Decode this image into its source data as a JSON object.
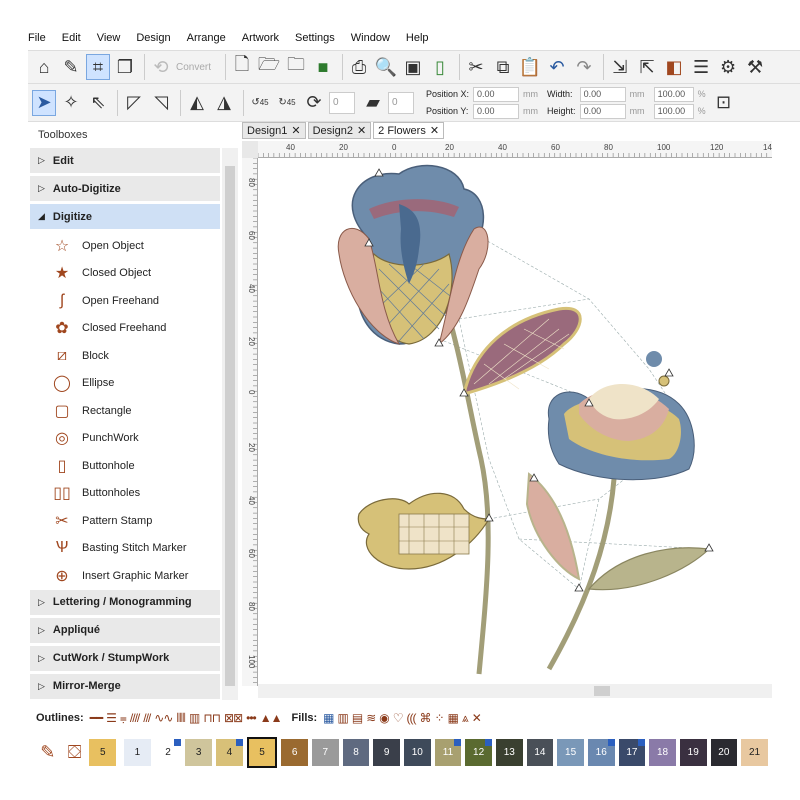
{
  "menu": [
    "File",
    "Edit",
    "View",
    "Design",
    "Arrange",
    "Artwork",
    "Settings",
    "Window",
    "Help"
  ],
  "toolbar": {
    "convert_label": "Convert",
    "angle_45a": "45",
    "angle_45b": "45",
    "zero_a": "0",
    "zero_b": "0"
  },
  "position": {
    "x_label": "Position X:",
    "x_value": "0.00",
    "x_unit": "mm",
    "y_label": "Position Y:",
    "y_value": "0.00",
    "y_unit": "mm",
    "width_label": "Width:",
    "width_value": "0.00",
    "width_unit": "mm",
    "height_label": "Height:",
    "height_value": "0.00",
    "height_unit": "mm",
    "scale_x": "100.00",
    "scale_y": "100.00",
    "percent": "%"
  },
  "toolboxes": {
    "title": "Toolboxes",
    "sections_top": [
      {
        "label": "Edit",
        "arrow": "▷"
      },
      {
        "label": "Auto-Digitize",
        "arrow": "▷"
      }
    ],
    "open_section": {
      "label": "Digitize",
      "arrow": "◢"
    },
    "tools": [
      {
        "label": "Open Object",
        "icon": "open-object-icon"
      },
      {
        "label": "Closed Object",
        "icon": "closed-object-icon"
      },
      {
        "label": "Open Freehand",
        "icon": "open-freehand-icon"
      },
      {
        "label": "Closed Freehand",
        "icon": "closed-freehand-icon"
      },
      {
        "label": "Block",
        "icon": "block-icon"
      },
      {
        "label": "Ellipse",
        "icon": "ellipse-icon"
      },
      {
        "label": "Rectangle",
        "icon": "rectangle-icon"
      },
      {
        "label": "PunchWork",
        "icon": "punchwork-icon"
      },
      {
        "label": "Buttonhole",
        "icon": "buttonhole-icon"
      },
      {
        "label": "Buttonholes",
        "icon": "buttonholes-icon"
      },
      {
        "label": "Pattern Stamp",
        "icon": "pattern-stamp-icon"
      },
      {
        "label": "Basting Stitch Marker",
        "icon": "basting-stitch-marker-icon"
      },
      {
        "label": "Insert Graphic Marker",
        "icon": "insert-graphic-marker-icon"
      }
    ],
    "sections_bottom": [
      {
        "label": "Lettering / Monogramming",
        "arrow": "▷"
      },
      {
        "label": "Appliqué",
        "arrow": "▷"
      },
      {
        "label": "CutWork / StumpWork",
        "arrow": "▷"
      },
      {
        "label": "Mirror-Merge",
        "arrow": "▷"
      }
    ]
  },
  "tabs": [
    {
      "label": "Design1",
      "active": false
    },
    {
      "label": "Design2",
      "active": false
    },
    {
      "label": "2 Flowers",
      "active": true
    }
  ],
  "tab_close": "✕",
  "ruler_h": [
    "40",
    "20",
    "0",
    "20",
    "40",
    "60",
    "80",
    "100",
    "120",
    "14"
  ],
  "ruler_v": [
    "80",
    "60",
    "40",
    "20",
    "0",
    "20",
    "40",
    "60",
    "80",
    "100"
  ],
  "outlines_label": "Outlines:",
  "fills_label": "Fills:",
  "current_color": "5",
  "colors": [
    {
      "n": "1",
      "hex": "#e6ecf5",
      "fg": "#222",
      "flag": false
    },
    {
      "n": "2",
      "hex": "#ffffff",
      "fg": "#222",
      "flag": true
    },
    {
      "n": "3",
      "hex": "#cfc59c",
      "fg": "#222",
      "flag": false
    },
    {
      "n": "4",
      "hex": "#d8c078",
      "fg": "#222",
      "flag": true
    },
    {
      "n": "5",
      "hex": "#e8c060",
      "fg": "#222",
      "flag": false
    },
    {
      "n": "6",
      "hex": "#9a6a30",
      "fg": "#fff",
      "flag": false
    },
    {
      "n": "7",
      "hex": "#9a9a9a",
      "fg": "#fff",
      "flag": false
    },
    {
      "n": "8",
      "hex": "#5f6a80",
      "fg": "#fff",
      "flag": false
    },
    {
      "n": "9",
      "hex": "#3a3f4a",
      "fg": "#fff",
      "flag": false
    },
    {
      "n": "10",
      "hex": "#3e4a5a",
      "fg": "#fff",
      "flag": false
    },
    {
      "n": "11",
      "hex": "#a8a070",
      "fg": "#fff",
      "flag": true
    },
    {
      "n": "12",
      "hex": "#5a6a30",
      "fg": "#fff",
      "flag": true
    },
    {
      "n": "13",
      "hex": "#3a4030",
      "fg": "#fff",
      "flag": false
    },
    {
      "n": "14",
      "hex": "#4a5058",
      "fg": "#fff",
      "flag": false
    },
    {
      "n": "15",
      "hex": "#7a98b8",
      "fg": "#fff",
      "flag": false
    },
    {
      "n": "16",
      "hex": "#6a88b0",
      "fg": "#fff",
      "flag": true
    },
    {
      "n": "17",
      "hex": "#3a4a6a",
      "fg": "#fff",
      "flag": true
    },
    {
      "n": "18",
      "hex": "#8a7aa8",
      "fg": "#fff",
      "flag": false
    },
    {
      "n": "19",
      "hex": "#3a3040",
      "fg": "#fff",
      "flag": false
    },
    {
      "n": "20",
      "hex": "#2a2a30",
      "fg": "#fff",
      "flag": false
    },
    {
      "n": "21",
      "hex": "#e8c8a0",
      "fg": "#222",
      "flag": false
    }
  ],
  "stitch_colors": {
    "blue": "#6f8cab",
    "rose": "#d9aea0",
    "gold": "#d6c178",
    "sage": "#b8b48c",
    "mauve": "#9a6a7c",
    "cream": "#efe3c8",
    "stem": "#a29e78"
  }
}
